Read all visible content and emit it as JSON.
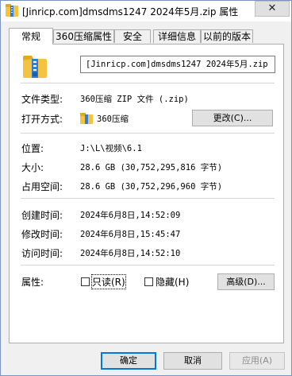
{
  "window": {
    "title": "[Jinricp.com]dmsdms1247 2024年5月.zip 属性",
    "close_glyph": "✕"
  },
  "tabs": [
    {
      "label": "常规"
    },
    {
      "label": "360压缩属性"
    },
    {
      "label": "安全"
    },
    {
      "label": "详细信息"
    },
    {
      "label": "以前的版本"
    }
  ],
  "general": {
    "file_name": "[Jinricp.com]dmsdms1247 2024年5月.zip",
    "type_label": "文件类型:",
    "type_value": "360压缩 ZIP 文件 (.zip)",
    "open_with_label": "打开方式:",
    "open_with_value": "360压缩",
    "change_button": "更改(C)...",
    "location_label": "位置:",
    "location_value": "J:\\L\\视频\\6.1",
    "size_label": "大小:",
    "size_value": "28.6 GB (30,752,295,816 字节)",
    "size_on_disk_label": "占用空间:",
    "size_on_disk_value": "28.6 GB (30,752,296,960 字节)",
    "created_label": "创建时间:",
    "created_value": "2024年6月8日,14:52:09",
    "modified_label": "修改时间:",
    "modified_value": "2024年6月8日,15:45:47",
    "accessed_label": "访问时间:",
    "accessed_value": "2024年6月8日,14:52:10",
    "attributes_label": "属性:",
    "readonly_label": "只读(R)",
    "hidden_label": "隐藏(H)",
    "advanced_button": "高级(D)..."
  },
  "footer": {
    "ok_button": "确定",
    "cancel_button": "取消",
    "apply_button": "应用(A)"
  },
  "icons": {
    "title": "zip-archive-icon",
    "file": "zip-archive-icon",
    "open_with": "360-zip-icon"
  },
  "colors": {
    "folder_yellow": "#f5c242",
    "zip_blue": "#2f7fd8",
    "focus_blue": "#0078d7"
  }
}
